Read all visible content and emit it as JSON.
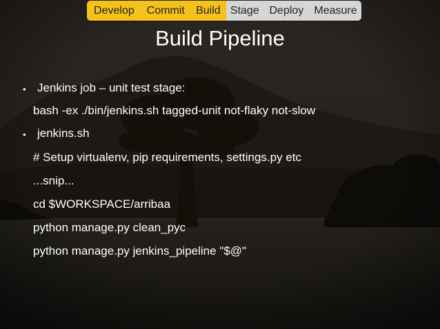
{
  "pipeline": {
    "stages": [
      {
        "label": "Develop",
        "state": "active"
      },
      {
        "label": "Commit",
        "state": "active"
      },
      {
        "label": "Build",
        "state": "active"
      },
      {
        "label": "Stage",
        "state": "inactive"
      },
      {
        "label": "Deploy",
        "state": "inactive"
      },
      {
        "label": "Measure",
        "state": "inactive"
      }
    ]
  },
  "slide": {
    "title": "Build Pipeline",
    "bullet_char": "•",
    "items": [
      {
        "text": "Jenkins job – unit test stage:"
      },
      {
        "text": "bash -ex ./bin/jenkins.sh tagged-unit not-flaky not-slow"
      },
      {
        "text": "jenkins.sh"
      },
      {
        "text": "# Setup virtualenv, pip requirements, settings.py etc"
      },
      {
        "text": "...snip..."
      },
      {
        "text": "cd $WORKSPACE/arribaa"
      },
      {
        "text": "python manage.py clean_pyc"
      },
      {
        "text": "python manage.py jenkins_pipeline \"$@\""
      }
    ]
  },
  "colors": {
    "active_stage": "#f5c21b",
    "inactive_stage": "#d6d6d6",
    "text": "#ffffff",
    "background": "#171411"
  }
}
